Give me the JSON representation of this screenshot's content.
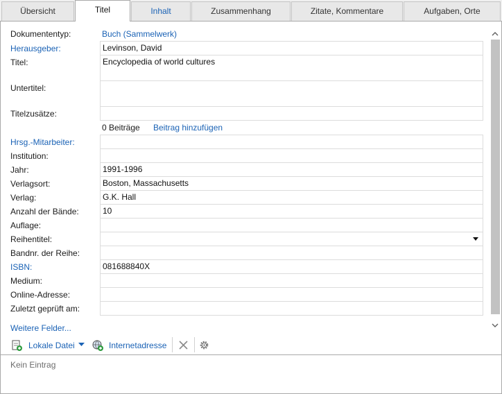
{
  "tabs": [
    {
      "label": "Übersicht"
    },
    {
      "label": "Titel"
    },
    {
      "label": "Inhalt"
    },
    {
      "label": "Zusammenhang"
    },
    {
      "label": "Zitate, Kommentare"
    },
    {
      "label": "Aufgaben, Orte"
    }
  ],
  "fields": {
    "dokumententyp": {
      "label": "Dokumententyp:",
      "value": "Buch (Sammelwerk)"
    },
    "herausgeber": {
      "label": "Herausgeber:",
      "value": "Levinson, David"
    },
    "titel": {
      "label": "Titel:",
      "value": "Encyclopedia of world cultures"
    },
    "untertitel": {
      "label": "Untertitel:",
      "value": ""
    },
    "titelzusaetze": {
      "label": "Titelzusätze:",
      "value": ""
    },
    "beitraege": {
      "count": "0 Beiträge",
      "add_link": "Beitrag hinzufügen"
    },
    "mitarbeiter": {
      "label": "Hrsg.-Mitarbeiter:",
      "value": ""
    },
    "institution": {
      "label": "Institution:",
      "value": ""
    },
    "jahr": {
      "label": "Jahr:",
      "value": "1991-1996"
    },
    "verlagsort": {
      "label": "Verlagsort:",
      "value": "Boston, Massachusetts"
    },
    "verlag": {
      "label": "Verlag:",
      "value": "G.K. Hall"
    },
    "baende": {
      "label": "Anzahl der Bände:",
      "value": "10"
    },
    "auflage": {
      "label": "Auflage:",
      "value": ""
    },
    "reihentitel": {
      "label": "Reihentitel:",
      "value": ""
    },
    "bandnr": {
      "label": "Bandnr. der Reihe:",
      "value": ""
    },
    "isbn": {
      "label": "ISBN:",
      "value": "081688840X"
    },
    "medium": {
      "label": "Medium:",
      "value": ""
    },
    "online": {
      "label": "Online-Adresse:",
      "value": ""
    },
    "geprueft": {
      "label": "Zuletzt geprüft am:",
      "value": ""
    }
  },
  "more_fields": "Weitere Felder...",
  "toolbar": {
    "local_file": "Lokale Datei",
    "internet": "Internetadresse"
  },
  "status": "Kein Eintrag",
  "colors": {
    "link": "#1a62b5",
    "muted": "#6d6d6d"
  },
  "icons": {
    "local_file": "local-file-icon",
    "internet": "internet-address-icon",
    "delete": "delete-x-icon",
    "settings": "gear-icon"
  }
}
